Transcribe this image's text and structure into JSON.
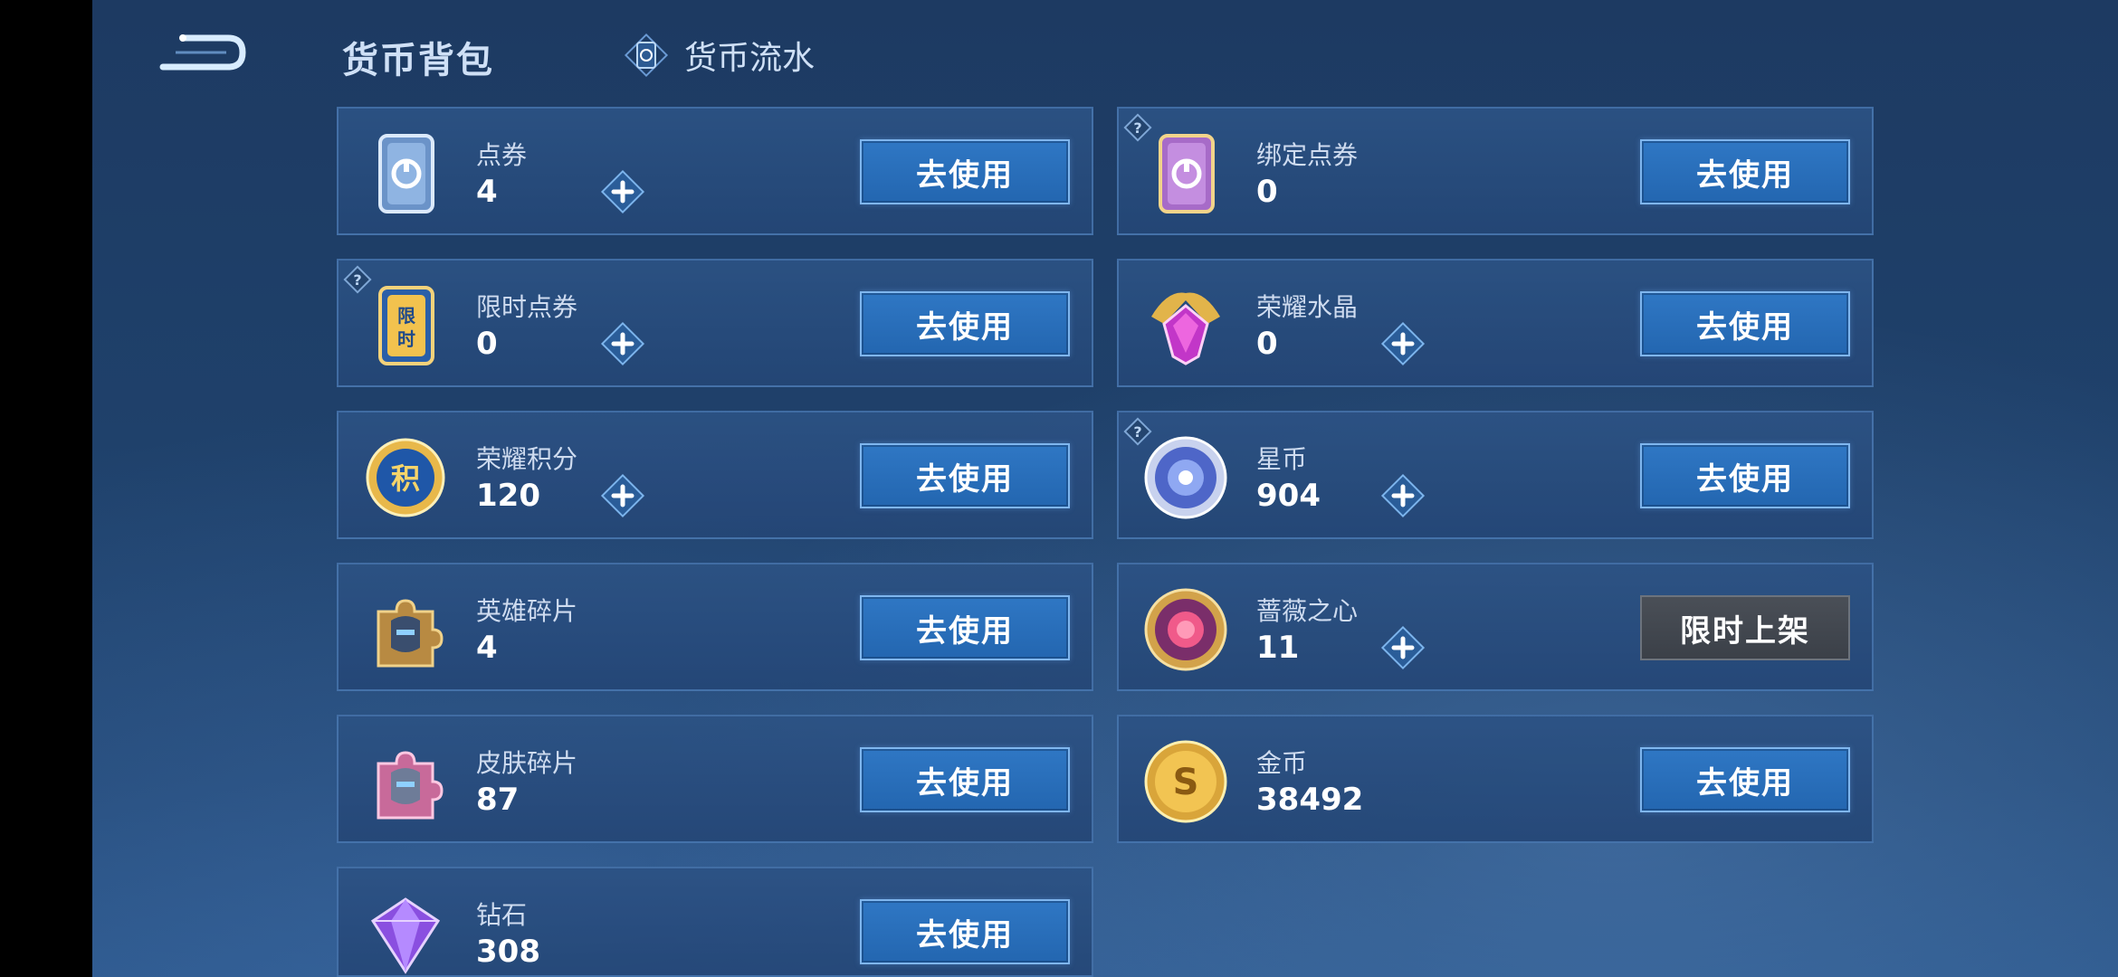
{
  "header": {
    "title": "货币背包",
    "flow_tab": "货币流水"
  },
  "currencies": [
    {
      "name": "点券",
      "value": "4",
      "button": "去使用",
      "icon": "coupon-card-icon",
      "plus": true,
      "help": false
    },
    {
      "name": "绑定点券",
      "value": "0",
      "button": "去使用",
      "icon": "bound-coupon-icon",
      "plus": false,
      "help": true
    },
    {
      "name": "限时点券",
      "value": "0",
      "button": "去使用",
      "icon": "limited-coupon-icon",
      "plus": true,
      "help": true
    },
    {
      "name": "荣耀水晶",
      "value": "0",
      "button": "去使用",
      "icon": "glory-crystal-icon",
      "plus": true,
      "help": false
    },
    {
      "name": "荣耀积分",
      "value": "120",
      "button": "去使用",
      "icon": "glory-points-icon",
      "plus": true,
      "help": false
    },
    {
      "name": "星币",
      "value": "904",
      "button": "去使用",
      "icon": "star-coin-icon",
      "plus": true,
      "help": true
    },
    {
      "name": "英雄碎片",
      "value": "4",
      "button": "去使用",
      "icon": "hero-fragment-icon",
      "plus": false,
      "help": false
    },
    {
      "name": "蔷薇之心",
      "value": "11",
      "button": "限时上架",
      "icon": "rose-heart-icon",
      "plus": true,
      "help": false
    },
    {
      "name": "皮肤碎片",
      "value": "87",
      "button": "去使用",
      "icon": "skin-fragment-icon",
      "plus": false,
      "help": false
    },
    {
      "name": "金币",
      "value": "38492",
      "button": "去使用",
      "icon": "gold-coin-icon",
      "plus": false,
      "help": false
    },
    {
      "name": "钻石",
      "value": "308",
      "button": "去使用",
      "icon": "diamond-icon",
      "plus": false,
      "help": false
    }
  ],
  "colors": {
    "accent_button": "#2f77c4",
    "disabled_button": "#4a4f57",
    "background": "#1f416b"
  }
}
